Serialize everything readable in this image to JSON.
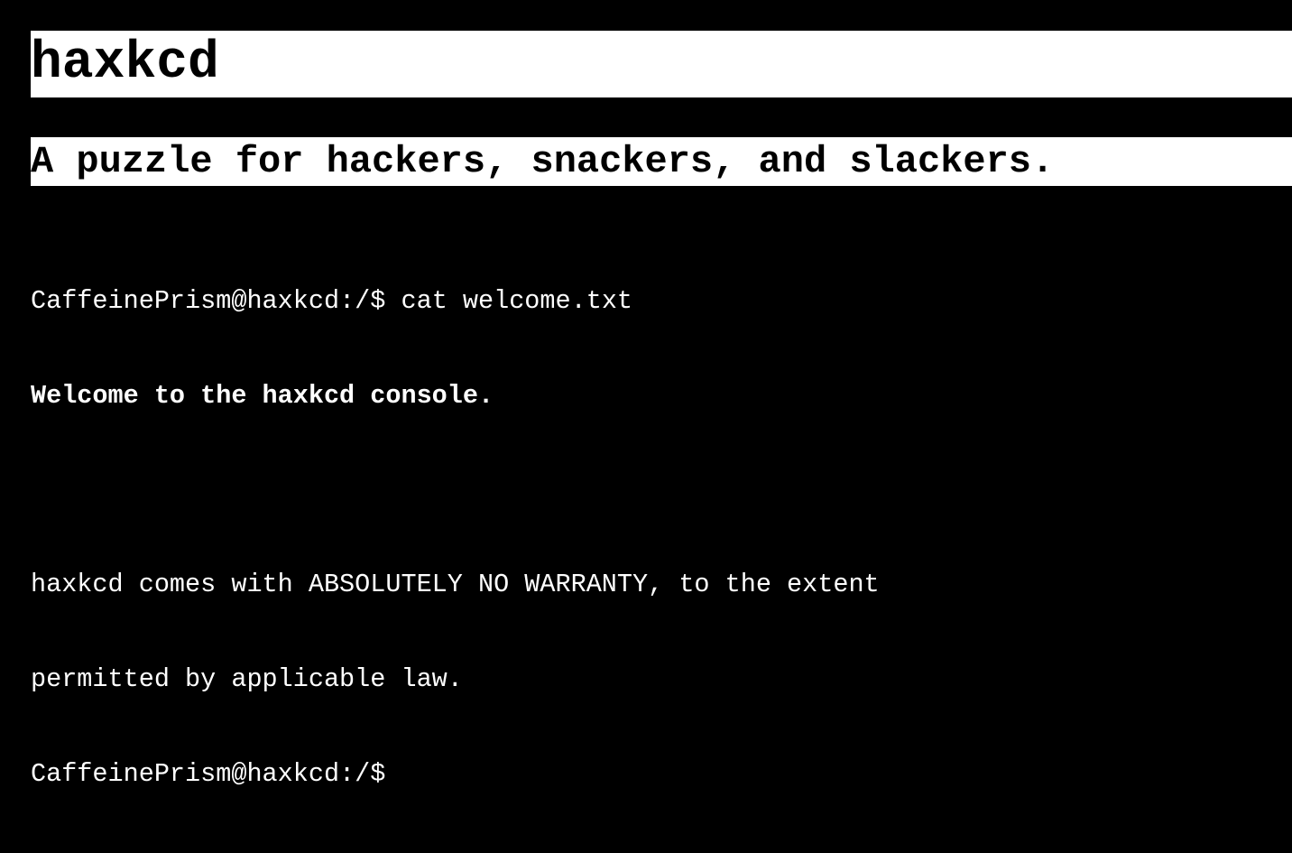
{
  "header": {
    "title": "haxkcd",
    "subtitle": "A puzzle for hackers, snackers, and slackers."
  },
  "console": {
    "prompt": "CaffeinePrism@haxkcd:/$",
    "command": "cat welcome.txt",
    "welcome_line": "Welcome to the haxkcd console.",
    "warranty_line_1": "haxkcd comes with ABSOLUTELY NO WARRANTY, to the extent",
    "warranty_line_2": "permitted by applicable law.",
    "current_input": ""
  },
  "colors": {
    "background": "#000000",
    "foreground": "#ffffff"
  }
}
